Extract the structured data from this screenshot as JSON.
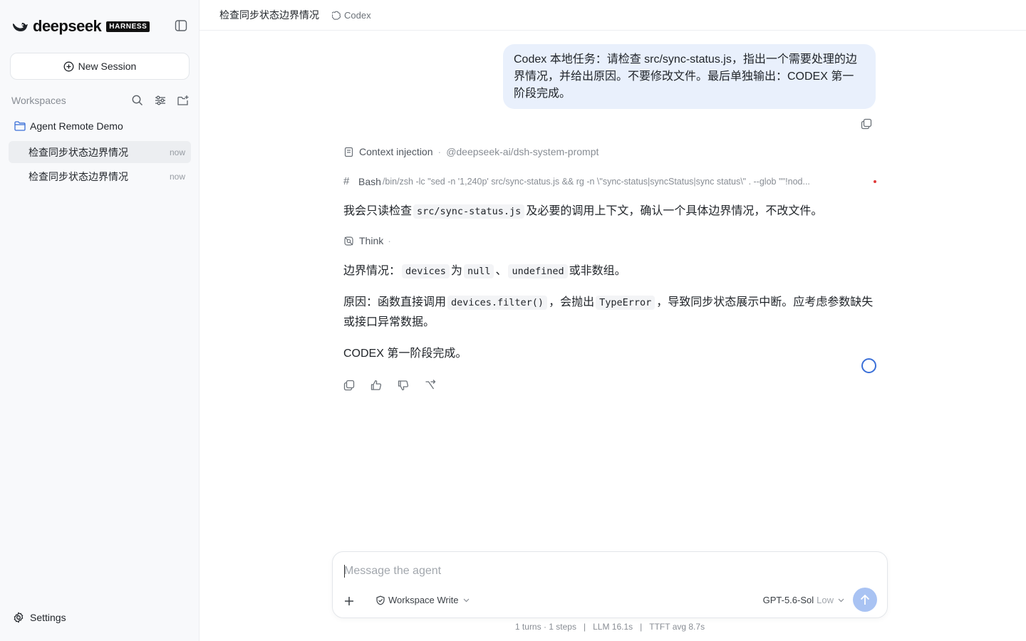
{
  "sidebar": {
    "brand_name": "deepseek",
    "brand_badge": "HARNESS",
    "new_session_label": "New Session",
    "workspaces_label": "Workspaces",
    "project_name": "Agent Remote Demo",
    "sessions": [
      {
        "label": "检查同步状态边界情况",
        "time": "now"
      },
      {
        "label": "检查同步状态边界情况",
        "time": "now"
      }
    ],
    "settings_label": "Settings"
  },
  "topbar": {
    "title": "检查同步状态边界情况",
    "agent": "Codex"
  },
  "conversation": {
    "user_message": "Codex 本地任务：请检查 src/sync-status.js，指出一个需要处理的边界情况，并给出原因。不要修改文件。最后单独输出：CODEX 第一阶段完成。",
    "context_label": "Context injection",
    "context_source": "@deepseek-ai/dsh-system-prompt",
    "bash_label": "Bash",
    "bash_command": "/bin/zsh -lc \"sed -n '1,240p' src/sync-status.js && rg -n \\\"sync-status|syncStatus|sync status\\\" . --glob '\"'!nod...",
    "p1": {
      "a": "我会只读检查",
      "code": "src/sync-status.js",
      "b": "及必要的调用上下文，确认一个具体边界情况，不改文件。"
    },
    "think_label": "Think",
    "p2": {
      "a": "边界情况：",
      "code1": "devices",
      "b": "为",
      "code2": "null",
      "c": "、",
      "code3": "undefined",
      "d": "或非数组。"
    },
    "p3": {
      "a": "原因：函数直接调用",
      "code1": "devices.filter()",
      "b": "，会抛出",
      "code2": "TypeError",
      "c": "，导致同步状态展示中断。应考虑参数缺失或接口异常数据。"
    },
    "p4": "CODEX 第一阶段完成。"
  },
  "composer": {
    "placeholder": "Message the agent",
    "permission": "Workspace Write",
    "model": "GPT-5.6-Sol",
    "effort": "Low"
  },
  "stats": {
    "turns": "1 turns · 1 steps",
    "llm": "LLM 16.1s",
    "ttft": "TTFT avg 8.7s"
  },
  "colors": {
    "accent": "#3a6fd8",
    "user_bubble": "#e9f0fc",
    "send_button": "#a9c3f3",
    "sidebar_bg": "#f8f9fb"
  }
}
